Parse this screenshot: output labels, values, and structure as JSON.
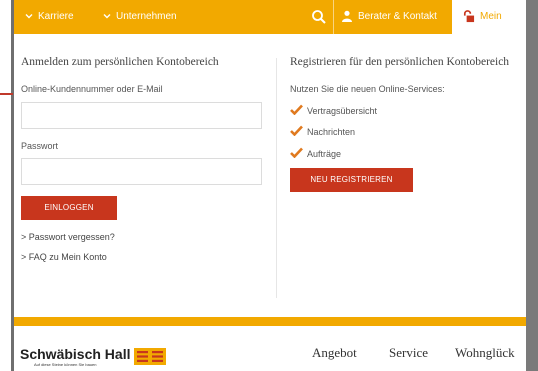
{
  "topbar": {
    "items": [
      {
        "label": "Karriere",
        "icon": "chevron-down-icon"
      },
      {
        "label": "Unternehmen",
        "icon": "chevron-down-icon"
      }
    ],
    "search_icon": "search-icon",
    "advisor_label": "Berater & Kontakt",
    "advisor_icon": "person-icon",
    "account_label": "Mein Konto",
    "account_icon": "lock-icon",
    "accent_color": "#f2a900"
  },
  "login": {
    "heading": "Anmelden zum persönlichen Kontobereich",
    "customer_label": "Online-Kundennummer oder E-Mail",
    "customer_value": "",
    "password_label": "Passwort",
    "password_value": "",
    "login_button": "EINLOGGEN",
    "forgot_link": "> Passwort vergessen?",
    "faq_link": "> FAQ zu Mein Konto"
  },
  "register": {
    "heading": "Registrieren für den persönlichen Kontobereich",
    "intro": "Nutzen Sie die neuen Online-Services:",
    "services": [
      "Vertragsübersicht",
      "Nachrichten",
      "Aufträge"
    ],
    "check_icon": "checkmark-icon",
    "register_button": "NEU REGISTRIEREN",
    "button_color": "#c8361d"
  },
  "footer": {
    "brand": "Schwäbisch Hall",
    "tagline": "Auf diese Steine können Sie bauen",
    "nav": [
      "Angebot",
      "Service",
      "Wohnglück"
    ]
  }
}
